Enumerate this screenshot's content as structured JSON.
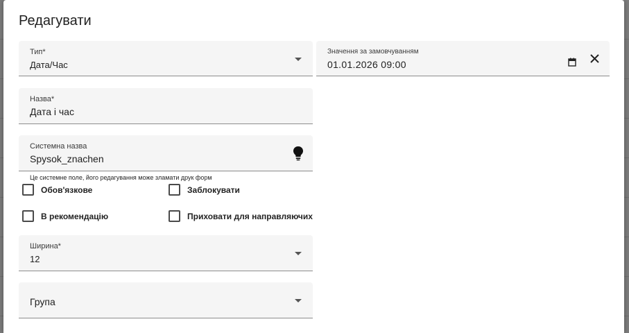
{
  "dialog": {
    "title": "Редагувати"
  },
  "fields": {
    "type": {
      "label": "Тип*",
      "value": "Дата/Час"
    },
    "default_value": {
      "label": "Значення за замовчуванням",
      "value": "01.01.2026 09:00"
    },
    "name": {
      "label": "Назва*",
      "value": "Дата і час"
    },
    "system_name": {
      "label": "Системна назва",
      "value": "Spysok_znachen",
      "helper": "Це системне поле, його редагування може зламати друк форм"
    },
    "width": {
      "label": "Ширина*",
      "value": "12"
    },
    "group": {
      "label": "Група"
    }
  },
  "checkboxes": {
    "required": {
      "label": "Обов'язкове",
      "checked": false
    },
    "lock": {
      "label": "Заблокувати",
      "checked": false
    },
    "recommendation": {
      "label": "В рекомендацію",
      "checked": false
    },
    "hide_for_referrers": {
      "label": "Приховати для направляючих",
      "checked": false
    }
  },
  "icons": {
    "calendar": "calendar-icon",
    "clear": "close-icon",
    "hint": "lightbulb-icon",
    "dropdown": "chevron-down-icon"
  },
  "colors": {
    "field_bg": "#f5f5f5",
    "text": "#212121",
    "underline": "#8c8c8c"
  }
}
